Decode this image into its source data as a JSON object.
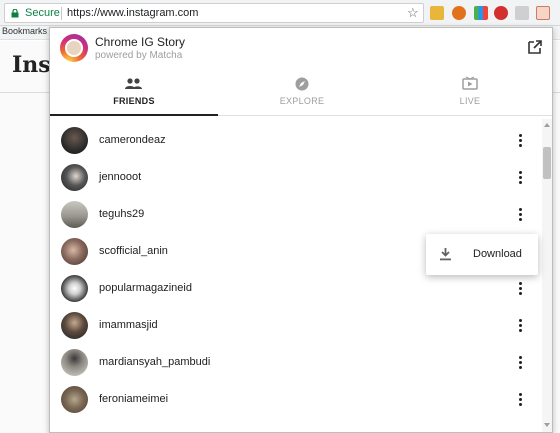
{
  "browser": {
    "secure_label": "Secure",
    "url": "https://www.instagram.com",
    "bookmarks_label": "Bookmarks",
    "accent_secure": "#0b8043"
  },
  "page": {
    "logo_text": "Insta"
  },
  "popup": {
    "title": "Chrome IG Story",
    "subtitle": "powered by Matcha",
    "open_icon": "open-in-new-icon",
    "tabs": [
      {
        "label": "FRIENDS",
        "icon": "people-icon",
        "active": true
      },
      {
        "label": "EXPLORE",
        "icon": "compass-icon",
        "active": false
      },
      {
        "label": "LIVE",
        "icon": "live-tv-icon",
        "active": false
      }
    ],
    "friends": [
      {
        "username": "camerondeaz",
        "avatar_color": "#2b2b2b"
      },
      {
        "username": "jennooot",
        "avatar_color": "#3a3a3a"
      },
      {
        "username": "teguhs29",
        "avatar_color": "#8a8a84"
      },
      {
        "username": "scofficial_anin",
        "avatar_color": "#6b5a55"
      },
      {
        "username": "popularmagazineid",
        "avatar_color": "#4a4a4a"
      },
      {
        "username": "imammasjid",
        "avatar_color": "#2e2e2e"
      },
      {
        "username": "mardiansyah_pambudi",
        "avatar_color": "#a7a29a"
      },
      {
        "username": "feroniameimei",
        "avatar_color": "#8a7a66"
      }
    ],
    "context_menu": {
      "item_label": "Download",
      "item_icon": "download-icon"
    }
  }
}
